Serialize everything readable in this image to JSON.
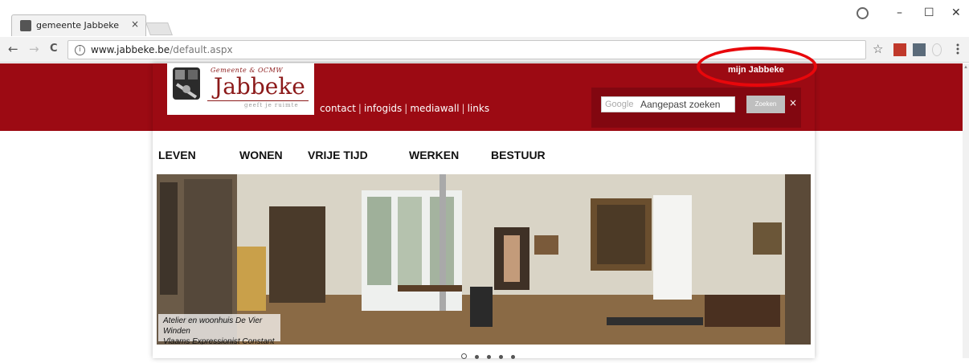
{
  "browser": {
    "tab_title": "gemeente Jabbeke",
    "tab_close": "×",
    "url_host": "www.jabbeke.be",
    "url_path": "/default.aspx",
    "window_controls": [
      "–",
      "☐",
      "✕"
    ],
    "nav_back": "←",
    "nav_forward": "→",
    "nav_reload": "C",
    "info_glyph": "i",
    "star": "☆"
  },
  "header": {
    "logo_small": "Gemeente & OCMW",
    "logo_big": "Jabbeke",
    "logo_tag": "geeft je ruimte",
    "links": [
      "contact",
      "infogids",
      "mediawall",
      "links"
    ],
    "link_separator": "|",
    "mijn": "mijn Jabbeke",
    "search_brand": "Google",
    "search_placeholder": "Aangepast zoeken",
    "search_button": "Zoeken",
    "search_clear": "×"
  },
  "nav": [
    "LEVEN",
    "WONEN",
    "VRIJE TIJD",
    "WERKEN",
    "BESTUUR"
  ],
  "hero": {
    "caption_line1": "Atelier en woonhuis De Vier Winden",
    "caption_line2": "Vlaams Expressionist Constant Permeke"
  },
  "carousel": {
    "count": 5,
    "active": 1
  },
  "colors": {
    "brand_red": "#9c0a13",
    "dark_red": "#820710",
    "annotation_red": "#e8070b"
  }
}
